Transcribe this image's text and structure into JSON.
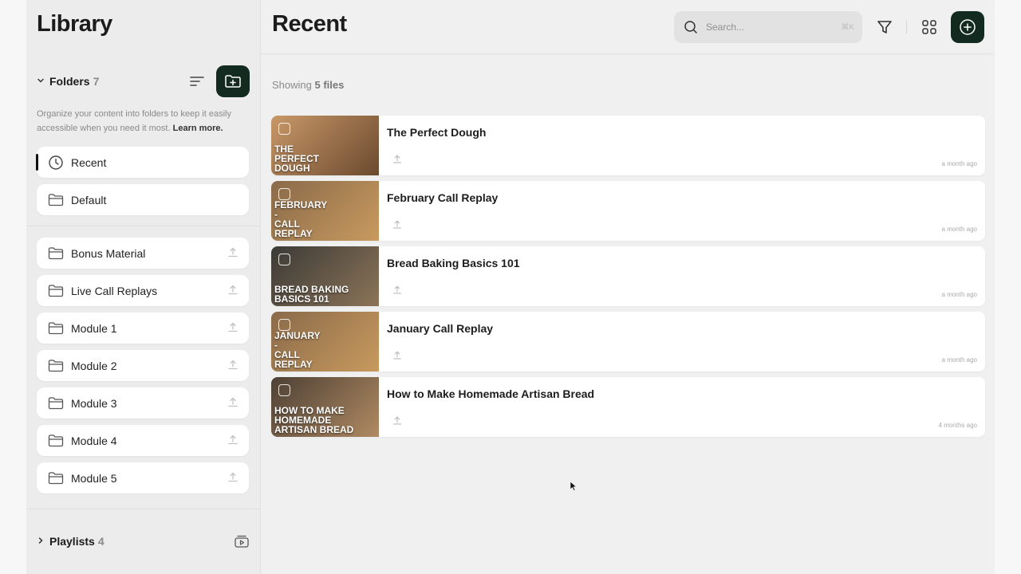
{
  "sidebar": {
    "title": "Library",
    "folders_label": "Folders",
    "folders_count": "7",
    "helper_text": "Organize your content into folders to keep it easily accessible when you need it most.",
    "learn_more": "Learn more.",
    "pinned_items": [
      {
        "label": "Recent",
        "icon": "clock-icon",
        "active": true
      },
      {
        "label": "Default",
        "icon": "folder-icon",
        "active": false
      }
    ],
    "folders": [
      {
        "label": "Bonus Material"
      },
      {
        "label": "Live Call Replays"
      },
      {
        "label": "Module 1"
      },
      {
        "label": "Module 2"
      },
      {
        "label": "Module 3"
      },
      {
        "label": "Module 4"
      },
      {
        "label": "Module 5"
      }
    ],
    "playlists_label": "Playlists",
    "playlists_count": "4"
  },
  "main": {
    "title": "Recent",
    "search_placeholder": "Search...",
    "search_shortcut": "⌘K",
    "showing_prefix": "Showing",
    "showing_count": "5 files",
    "files": [
      {
        "title": "The Perfect Dough",
        "thumb_text": "THE\nPERFECT\nDOUGH",
        "time": "a month ago",
        "thumb_colors": [
          "#c99868",
          "#6b4a2f"
        ]
      },
      {
        "title": "February Call Replay",
        "thumb_text": "FEBRUARY\n-\nCALL\nREPLAY",
        "time": "a month ago",
        "thumb_colors": [
          "#8a6a4a",
          "#c89a5e"
        ]
      },
      {
        "title": "Bread Baking Basics 101",
        "thumb_text": "BREAD BAKING\nBASICS 101",
        "time": "a month ago",
        "thumb_colors": [
          "#3b3a36",
          "#8c7458"
        ]
      },
      {
        "title": "January Call Replay",
        "thumb_text": "JANUARY\n-\nCALL\nREPLAY",
        "time": "a month ago",
        "thumb_colors": [
          "#8a6a4a",
          "#c89a5e"
        ]
      },
      {
        "title": "How to Make Homemade Artisan Bread",
        "thumb_text": "HOW TO MAKE\nHOMEMADE\nARTISAN BREAD",
        "time": "4 months ago",
        "thumb_colors": [
          "#4d4034",
          "#b08a62"
        ]
      }
    ]
  },
  "colors": {
    "accent_dark": "#132a20",
    "background": "#eff0ef",
    "card": "#ffffff"
  }
}
